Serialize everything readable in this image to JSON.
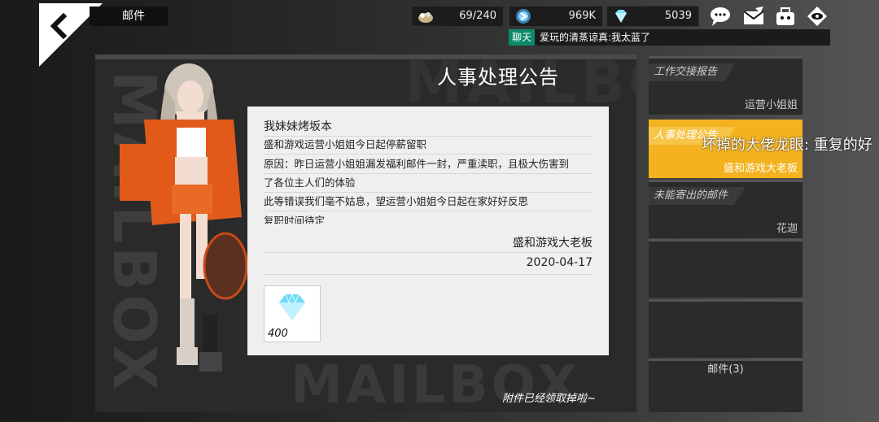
{
  "header": {
    "title": "邮件"
  },
  "resources": {
    "stamina": "69/240",
    "coins": "969K",
    "diamonds": "5039"
  },
  "chat": {
    "tag": "聊天",
    "message": "爱玩的清蒸谅真:我太蓝了"
  },
  "mail": {
    "title": "人事处理公告",
    "subject": "我妹妹烤坂本",
    "body": [
      "盛和游戏运营小姐姐今日起停薪留职",
      "原因：昨日运营小姐姐漏发福利邮件一封，严重渎职，且极大伤害到",
      "了各位主人们的体验",
      "此等错误我们毫不姑息，望运营小姐姐今日起在家好好反思",
      "复职时间待定"
    ],
    "sender": "盛和游戏大老板",
    "date": "2020-04-17",
    "attachment": {
      "icon": "diamond-icon",
      "count": "400"
    },
    "claimed_notice": "附件已经领取掉啦~",
    "watermark": "MAILBOX"
  },
  "mail_list": [
    {
      "title": "工作交接报告",
      "sender": "运营小姐姐"
    },
    {
      "title": "人事处理公告",
      "sender": "盛和游戏大老板",
      "selected": true
    },
    {
      "title": "未能寄出的邮件",
      "sender": "花迦"
    },
    {
      "title": "",
      "sender": ""
    },
    {
      "title": "",
      "sender": ""
    }
  ],
  "mail_count": "邮件(3)",
  "danmaku": "坏掉的大佬龙眼: 重复的好",
  "colors": {
    "accent": "#f3b21e",
    "chat_tag": "#0b8a6a",
    "diamond": "#7fe3ff"
  }
}
